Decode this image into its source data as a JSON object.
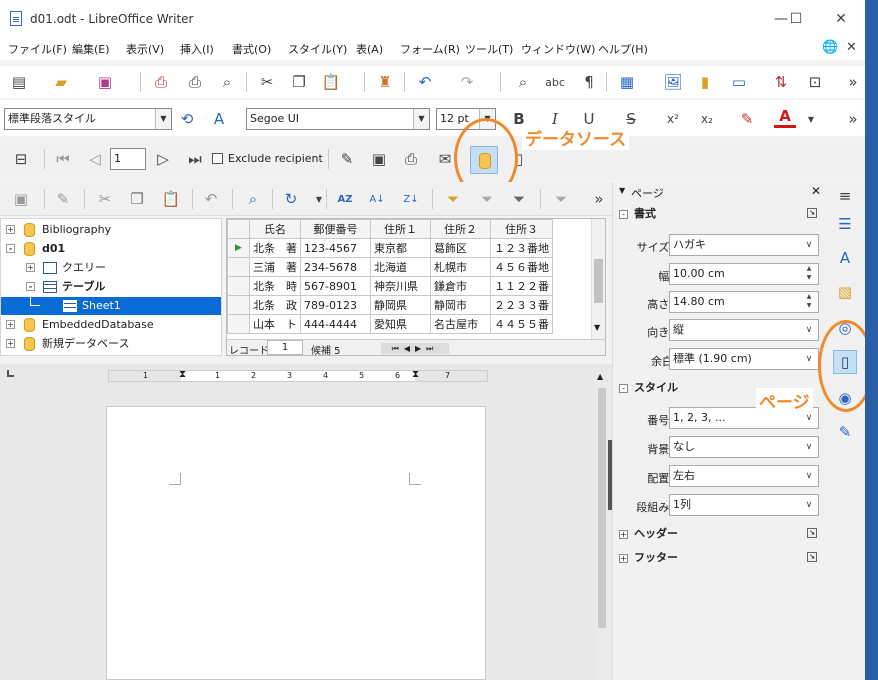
{
  "window": {
    "title": "d01.odt - LibreOffice Writer",
    "minimize": "—",
    "maximize": "☐",
    "close": "✕"
  },
  "menu": {
    "items": [
      "ファイル(F)",
      "編集(E)",
      "表示(V)",
      "挿入(I)",
      "書式(O)",
      "スタイル(Y)",
      "表(A)",
      "フォーム(R)",
      "ツール(T)",
      "ウィンドウ(W)",
      "ヘルプ(H)"
    ],
    "globe": "🌐",
    "close": "✕"
  },
  "formatting": {
    "paragraph_style": "標準段落スタイル",
    "font_name": "Segoe UI",
    "font_size": "12 pt",
    "bold": "B",
    "italic": "I",
    "underline": "U",
    "strike": "S",
    "superscript": "x²",
    "subscript": "x₂",
    "font_color": "A",
    "overflow": "»"
  },
  "mailmerge": {
    "record": "1",
    "exclude_label": "Exclude recipient"
  },
  "annotations": {
    "datasource": "データソース",
    "page": "ページ"
  },
  "db_tree": {
    "items": [
      {
        "label": "Bibliography",
        "expander": "+"
      },
      {
        "label": "d01",
        "expander": "-"
      },
      {
        "label": "クエリー",
        "expander": "+"
      },
      {
        "label": "テーブル",
        "expander": "-"
      },
      {
        "label": "Sheet1",
        "expander": ""
      },
      {
        "label": "EmbeddedDatabase",
        "expander": "+"
      },
      {
        "label": "新規データベース",
        "expander": "+"
      }
    ]
  },
  "grid": {
    "columns": [
      "氏名",
      "郵便番号",
      "住所１",
      "住所２",
      "住所３"
    ],
    "rows": [
      [
        "北条　著",
        "123-4567",
        "東京都",
        "葛飾区",
        "１２３番地"
      ],
      [
        "三浦　著",
        "234-5678",
        "北海道",
        "札幌市",
        "４５６番地"
      ],
      [
        "北条　時",
        "567-8901",
        "神奈川県",
        "鎌倉市",
        "１１２２番"
      ],
      [
        "北条　政",
        "789-0123",
        "静岡県",
        "静岡市",
        "２２３３番"
      ],
      [
        "山本　ト",
        "444-4444",
        "愛知県",
        "名古屋市",
        "４４５５番"
      ]
    ],
    "record_label": "レコード",
    "record_value": "1",
    "candidates": "候補 5"
  },
  "sidebar": {
    "title": "ページ",
    "close": "✕",
    "format_section": "書式",
    "size_label": "サイズ:",
    "size_value": "ハガキ",
    "width_label": "幅:",
    "width_value": "10.00 cm",
    "height_label": "高さ:",
    "height_value": "14.80 cm",
    "orientation_label": "向き:",
    "orientation_value": "縦",
    "margin_label": "余白",
    "margin_value": "標準 (1.90 cm)",
    "style_section": "スタイル",
    "number_label": "番号:",
    "number_value": "1, 2, 3, ...",
    "background_label": "背景:",
    "background_value": "なし",
    "layout_label": "配置:",
    "layout_value": "左右",
    "columns_label": "段組み:",
    "columns_value": "1列",
    "header_section": "ヘッダー",
    "footer_section": "フッター"
  },
  "ruler": {
    "labels": [
      "1",
      "1",
      "1",
      "2",
      "3",
      "4",
      "5",
      "6",
      "7"
    ]
  },
  "colors": {
    "accent": "#f08a2c",
    "selection": "#0a6bd4",
    "font_color_bar": "#d01818"
  }
}
